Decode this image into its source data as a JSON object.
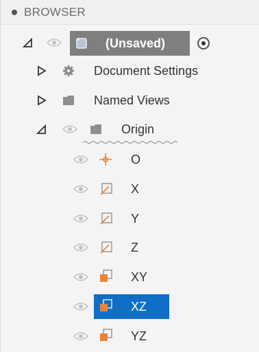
{
  "browser": {
    "title": "BROWSER"
  },
  "tree": {
    "root": {
      "label": "(Unsaved)"
    },
    "document_settings": {
      "label": "Document Settings"
    },
    "named_views": {
      "label": "Named Views"
    },
    "origin": {
      "label": "Origin",
      "items": [
        {
          "label": "O",
          "icon": "origin-point-icon"
        },
        {
          "label": "X",
          "icon": "axis-icon"
        },
        {
          "label": "Y",
          "icon": "axis-icon"
        },
        {
          "label": "Z",
          "icon": "axis-icon"
        },
        {
          "label": "XY",
          "icon": "plane-icon"
        },
        {
          "label": "XZ",
          "icon": "plane-icon",
          "selected": true
        },
        {
          "label": "YZ",
          "icon": "plane-icon"
        }
      ]
    }
  },
  "colors": {
    "selection": "#0f6fc6",
    "root_highlight": "#7f7f7f",
    "accent_orange": "#e8843a"
  }
}
